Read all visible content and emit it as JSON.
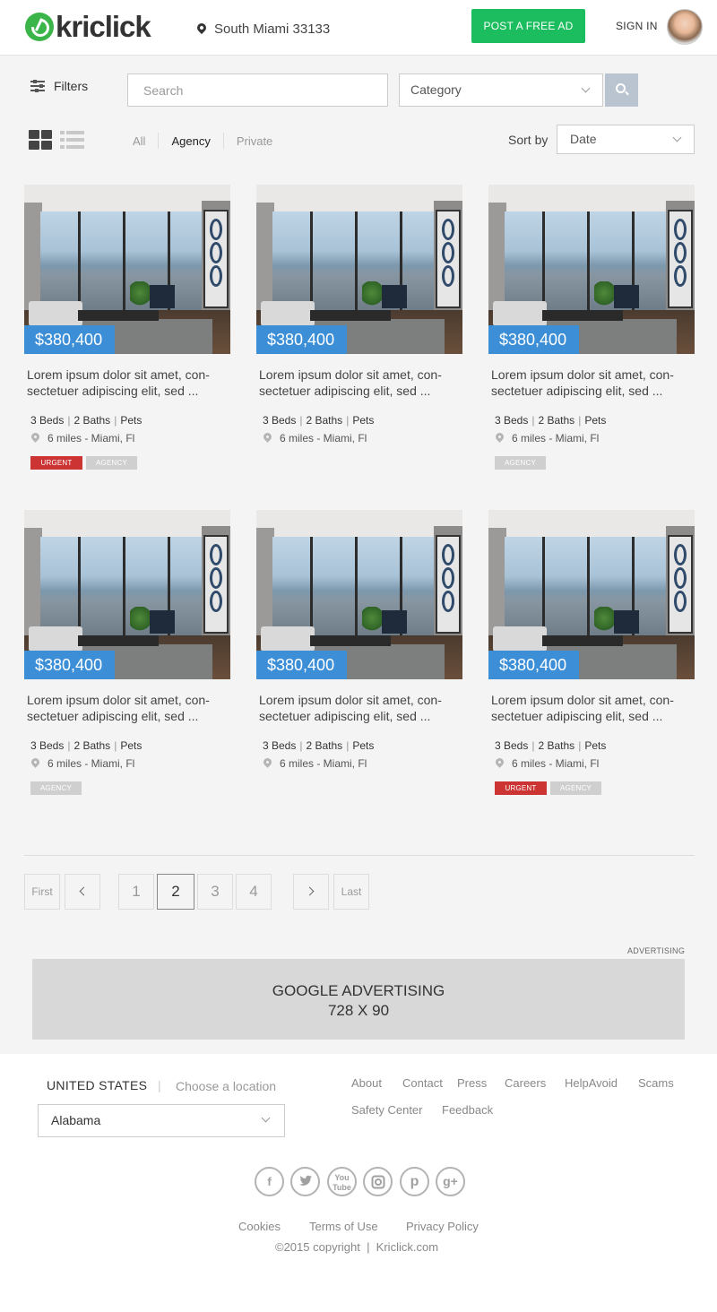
{
  "header": {
    "logo_text": "kriclick",
    "location": "South Miami 33133",
    "post_ad_label": "POST A FREE AD",
    "sign_in_label": "SIGN IN"
  },
  "toolbar": {
    "filters_label": "Filters",
    "search_placeholder": "Search",
    "category_label": "Category",
    "tabs": [
      "All",
      "Agency",
      "Private"
    ],
    "active_tab": "Agency",
    "sort_by_label": "Sort by",
    "sort_value": "Date"
  },
  "listings": [
    {
      "price": "$380,400",
      "title": "Lorem ipsum dolor sit amet, con-sectetuer adipiscing elit, sed ...",
      "beds": "3 Beds",
      "baths": "2 Baths",
      "pets": "Pets",
      "distance": "6 miles - Miami, Fl",
      "badges": [
        "URGENT",
        "AGENCY"
      ]
    },
    {
      "price": "$380,400",
      "title": "Lorem ipsum dolor sit amet, con-sectetuer adipiscing elit, sed ...",
      "beds": "3 Beds",
      "baths": "2 Baths",
      "pets": "Pets",
      "distance": "6 miles - Miami, Fl",
      "badges": []
    },
    {
      "price": "$380,400",
      "title": "Lorem ipsum dolor sit amet, con-sectetuer adipiscing elit, sed ...",
      "beds": "3 Beds",
      "baths": "2 Baths",
      "pets": "Pets",
      "distance": "6 miles - Miami, Fl",
      "badges": [
        "AGENCY"
      ]
    },
    {
      "price": "$380,400",
      "title": "Lorem ipsum dolor sit amet, con-sectetuer adipiscing elit, sed ...",
      "beds": "3 Beds",
      "baths": "2 Baths",
      "pets": "Pets",
      "distance": "6 miles - Miami, Fl",
      "badges": [
        "AGENCY"
      ]
    },
    {
      "price": "$380,400",
      "title": "Lorem ipsum dolor sit amet, con-sectetuer adipiscing elit, sed ...",
      "beds": "3 Beds",
      "baths": "2 Baths",
      "pets": "Pets",
      "distance": "6 miles - Miami, Fl",
      "badges": []
    },
    {
      "price": "$380,400",
      "title": "Lorem ipsum dolor sit amet, con-sectetuer adipiscing elit, sed ...",
      "beds": "3 Beds",
      "baths": "2 Baths",
      "pets": "Pets",
      "distance": "6 miles - Miami, Fl",
      "badges": [
        "URGENT",
        "AGENCY"
      ]
    }
  ],
  "pagination": {
    "first_label": "First",
    "last_label": "Last",
    "pages": [
      "1",
      "2",
      "3",
      "4"
    ],
    "current_page": "2"
  },
  "ad": {
    "label": "ADVERTISING",
    "line1": "GOOGLE ADVERTISING",
    "line2": "728 X 90"
  },
  "footer": {
    "country": "UNITED STATES",
    "separator": "|",
    "choose_location": "Choose a location",
    "state_value": "Alabama",
    "links": [
      "About",
      "Contact",
      "Press",
      "Careers",
      "HelpAvoid",
      "Scams",
      "Safety Center",
      "Feedback"
    ],
    "social_icons": [
      "facebook-icon",
      "twitter-icon",
      "youtube-icon",
      "instagram-icon",
      "pinterest-icon",
      "google-plus-icon"
    ],
    "legal_links": [
      "Cookies",
      "Terms of Use",
      "Privacy Policy"
    ],
    "copyright": "©2015 copyright  |  Kriclick.com"
  },
  "colors": {
    "brand_green": "#1cbd5e",
    "price_blue": "#3c8fd7",
    "urgent_red": "#cc3333"
  }
}
